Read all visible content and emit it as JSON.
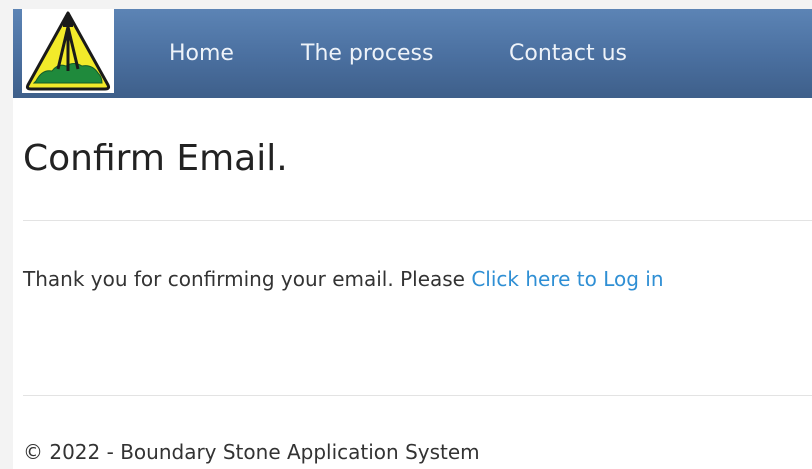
{
  "nav": {
    "items": [
      {
        "label": "Home"
      },
      {
        "label": "The process"
      },
      {
        "label": "Contact us"
      }
    ]
  },
  "logo": {
    "icon": "surveyor-tripod-logo-icon",
    "colors": {
      "triangle": "#f2ea2a",
      "land": "#1f8a3c",
      "outline": "#1a1a1a"
    }
  },
  "main": {
    "title": "Confirm Email.",
    "message_text": "Thank you for confirming your email. Please ",
    "login_link": "Click here to Log in"
  },
  "footer": {
    "text": "© 2022 - Boundary Stone Application System"
  },
  "colors": {
    "navbar_top": "#5c84b5",
    "navbar_bottom": "#3e5f8a",
    "link": "#2f8fd4",
    "text": "#333333"
  }
}
